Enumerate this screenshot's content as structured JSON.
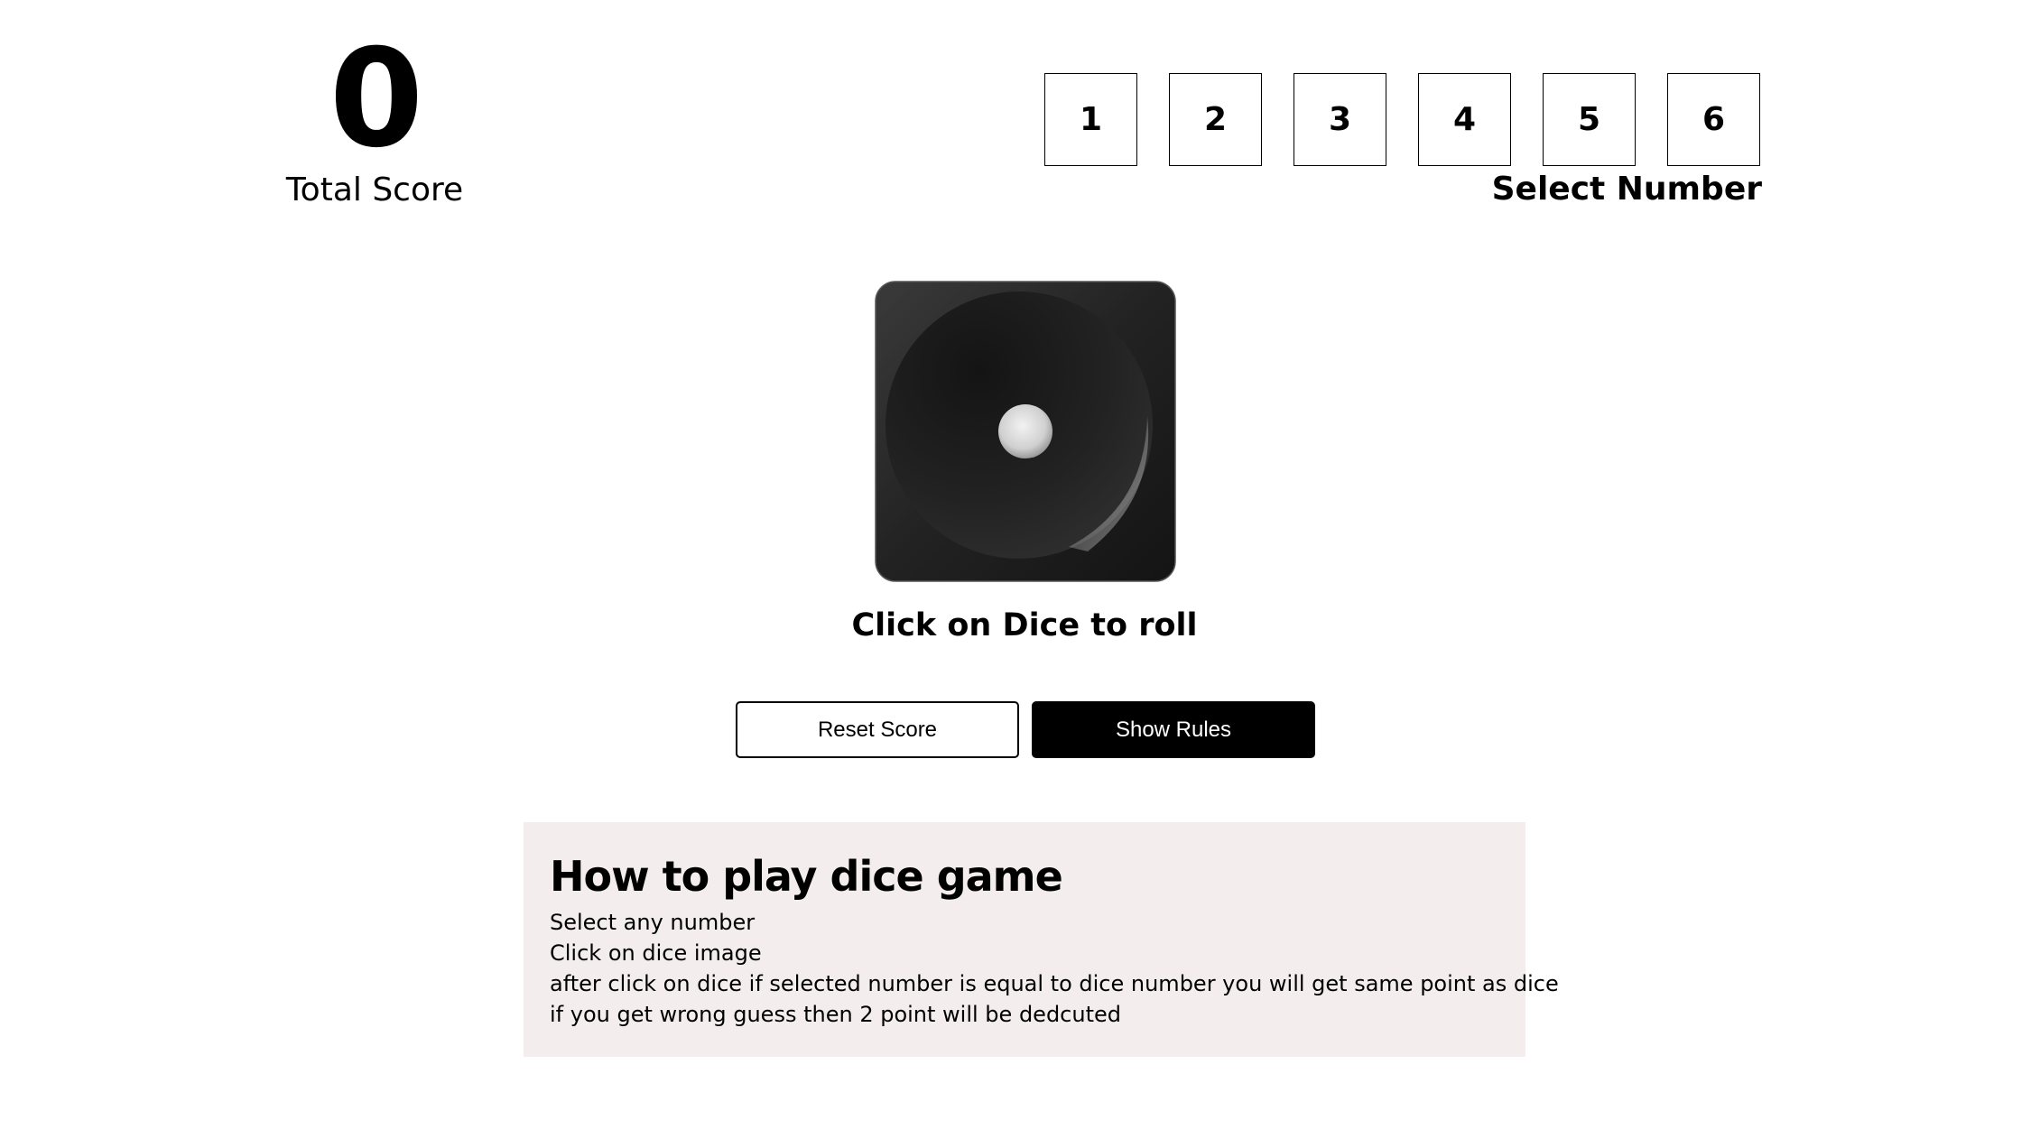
{
  "score": {
    "value": "0",
    "label": "Total Score"
  },
  "selector": {
    "numbers": [
      "1",
      "2",
      "3",
      "4",
      "5",
      "6"
    ],
    "label": "Select Number"
  },
  "dice": {
    "face": 1,
    "instruction": "Click on Dice to roll"
  },
  "buttons": {
    "reset_label": "Reset Score",
    "rules_label": "Show Rules"
  },
  "rules": {
    "title": "How to play dice game",
    "lines": [
      "Select any number",
      "Click on dice image",
      "after click on dice if selected number is equal to dice number you will get same point as dice",
      "if you get wrong guess then 2 point will be dedcuted"
    ]
  },
  "colors": {
    "rules_bg": "#f3eded",
    "primary": "#000000",
    "dice_body": "#1c1c1c"
  }
}
